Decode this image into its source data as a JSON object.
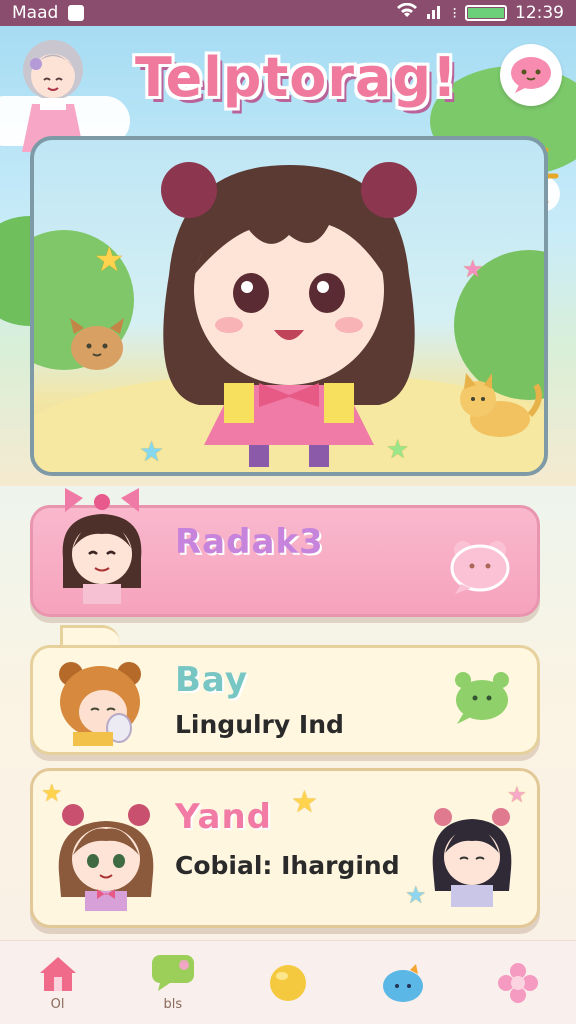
{
  "status_bar": {
    "carrier": "Maad",
    "time": "12:39"
  },
  "header": {
    "app_title": "Telptorag!"
  },
  "cards": [
    {
      "title": "Radak3",
      "subtitle": ""
    },
    {
      "title": "Bay",
      "subtitle": "Lingulry Ind"
    },
    {
      "title": "Yand",
      "subtitle": "Cobial: Ihargind"
    }
  ],
  "nav": {
    "items": [
      {
        "label": "Ol",
        "icon": "home-icon"
      },
      {
        "label": "bls",
        "icon": "chat-bubble-icon"
      },
      {
        "label": "",
        "icon": "orb-icon"
      },
      {
        "label": "",
        "icon": "blob-icon"
      },
      {
        "label": "",
        "icon": "flower-icon"
      }
    ]
  },
  "colors": {
    "status_bar": "#8a4d6e",
    "card_pink": "#f6a3bd",
    "card_cream": "#fff7df",
    "title_pink": "#f07a9e"
  }
}
